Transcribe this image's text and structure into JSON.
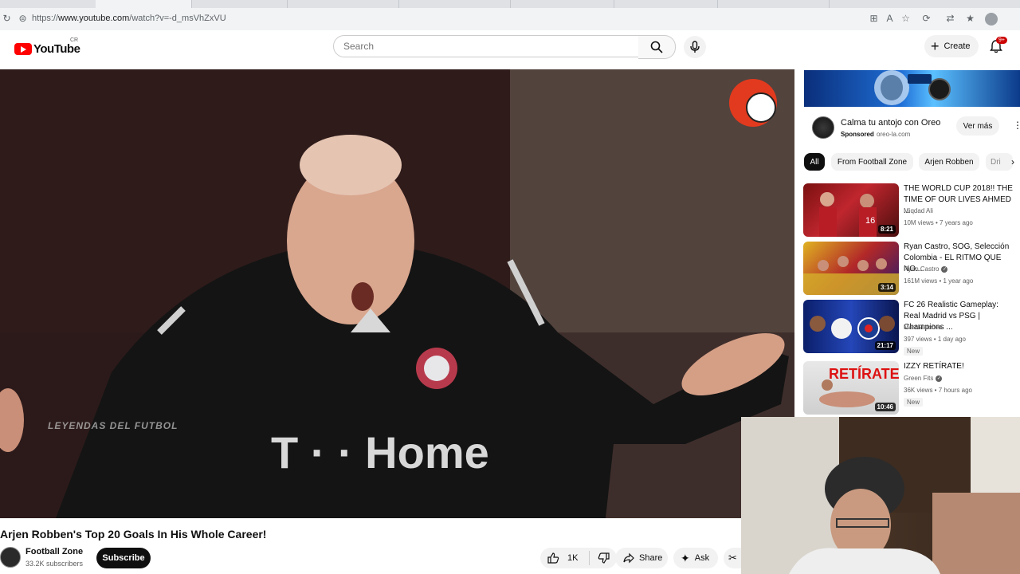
{
  "browser": {
    "url_prefix": "https://",
    "url_domain": "www.youtube.com",
    "url_path": "/watch?v=-d_msVhZxVU"
  },
  "header": {
    "logo_text": "YouTube",
    "country_code": "CR",
    "search_placeholder": "Search",
    "create_label": "Create",
    "notification_count": "9+"
  },
  "video": {
    "watermark": "LEYENDAS DEL FUTBOL",
    "title": "Arjen Robben's Top 20 Goals In His Whole Career!",
    "channel": "Football Zone",
    "subscribers": "33.2K subscribers",
    "subscribe_label": "Subscribe",
    "likes": "1K",
    "share_label": "Share",
    "ask_label": "Ask"
  },
  "ad": {
    "title": "Calma tu antojo con Oreo",
    "sponsored": "Sponsored",
    "domain": "oreo-la.com",
    "cta": "Ver más"
  },
  "chips": [
    "All",
    "From Football Zone",
    "Arjen Robben",
    "Dri"
  ],
  "recommendations": [
    {
      "title": "THE WORLD CUP 2018!! THE TIME OF OUR LIVES  AHMED ...",
      "channel": "Miqdad Ali",
      "meta": "10M views • 7 years ago",
      "duration": "8:21",
      "new": ""
    },
    {
      "title": "Ryan Castro, SOG, Selección Colombia - EL RITMO QUE NO...",
      "channel": "Ryan Castro",
      "meta": "161M views • 1 year ago",
      "duration": "3:14",
      "new": ""
    },
    {
      "title": "FC 26 Realistic Gameplay: Real Madrid vs PSG | Champions ...",
      "channel": "MarcMatches",
      "meta": "397 views • 1 day ago",
      "duration": "21:17",
      "new": "New"
    },
    {
      "title": "IZZY RETÍRATE!",
      "channel": "Green Fits",
      "meta": "36K views • 7 hours ago",
      "duration": "10:46",
      "new": "New"
    }
  ],
  "colors": {
    "youtube_red": "#ff0000",
    "subscribe_bg": "#0f0f0f",
    "chip_bg": "#f2f2f2"
  }
}
